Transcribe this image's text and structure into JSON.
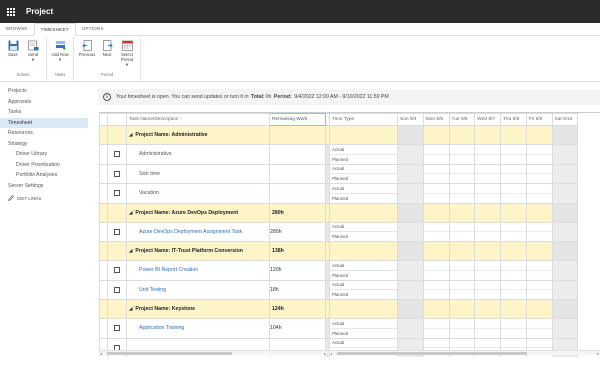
{
  "app": {
    "title": "Project"
  },
  "tabs": [
    "BROWSE",
    "TIMESHEET",
    "OPTIONS"
  ],
  "ribbon": {
    "groups": [
      {
        "label": "Submit",
        "buttons": [
          {
            "label": "Save",
            "icon": "save-icon"
          },
          {
            "label": "Send",
            "icon": "send-icon",
            "dropdown": true
          }
        ]
      },
      {
        "label": "Tasks",
        "buttons": [
          {
            "label": "Add Row",
            "icon": "add-row-icon",
            "dropdown": true
          }
        ]
      },
      {
        "label": "Period",
        "buttons": [
          {
            "label": "Previous",
            "icon": "previous-icon"
          },
          {
            "label": "Next",
            "icon": "next-icon"
          },
          {
            "label": "Select Period",
            "icon": "calendar-icon",
            "dropdown": true
          }
        ]
      }
    ]
  },
  "nav": {
    "items": [
      {
        "label": "Projects",
        "sub": false
      },
      {
        "label": "Approvals",
        "sub": false
      },
      {
        "label": "Tasks",
        "sub": false
      },
      {
        "label": "Timesheet",
        "sub": false,
        "selected": true
      },
      {
        "label": "Resources",
        "sub": false
      },
      {
        "label": "Strategy",
        "sub": false
      },
      {
        "label": "Driver Library",
        "sub": true
      },
      {
        "label": "Driver Prioritization",
        "sub": true
      },
      {
        "label": "Portfolio Analyses",
        "sub": true
      },
      {
        "label": "Server Settings",
        "sub": false
      }
    ],
    "edit_links": "EDIT LINKS"
  },
  "info": {
    "message": "Your timesheet is open. You can send updates or turn it in",
    "total_label": "Total:",
    "total_value": "0h",
    "period_label": "Period:",
    "period_value": "9/4/2022 12:00 AM - 9/10/2022 11:59 PM"
  },
  "grid": {
    "headers": {
      "name": "Task Name/Description",
      "remaining": "Remaining Work",
      "time_type": "Time Type",
      "days": [
        "Sun 9/4",
        "Mon 9/5",
        "Tue 9/6",
        "Wed 9/7",
        "Thu 9/8",
        "Fri 9/9",
        "Sat 9/10"
      ]
    },
    "time_types": [
      "Actual",
      "Planned"
    ],
    "rows": [
      {
        "kind": "project",
        "name": "Project Name: Administrative",
        "remaining": ""
      },
      {
        "kind": "task",
        "name": "Administrative",
        "remaining": "",
        "link": false
      },
      {
        "kind": "task",
        "name": "Sick time",
        "remaining": "",
        "link": false
      },
      {
        "kind": "task",
        "name": "Vacation",
        "remaining": "",
        "link": false
      },
      {
        "kind": "project",
        "name": "Project Name: Azure DevOps Deployment",
        "remaining": "280h"
      },
      {
        "kind": "task",
        "name": "Azure DevOps Deployment Assignment Task",
        "remaining": "280h",
        "link": true
      },
      {
        "kind": "project",
        "name": "Project Name: IT-Trust Platform Conversion",
        "remaining": "138h"
      },
      {
        "kind": "task",
        "name": "Power BI Report Creation",
        "remaining": "120h",
        "link": true
      },
      {
        "kind": "task",
        "name": "Unit Testing",
        "remaining": "18h",
        "link": true
      },
      {
        "kind": "project",
        "name": "Project Name: Keystone",
        "remaining": "124h"
      },
      {
        "kind": "task",
        "name": "Application Training",
        "remaining": "104h",
        "link": true
      },
      {
        "kind": "task",
        "name": "",
        "remaining": "",
        "link": true
      }
    ]
  }
}
